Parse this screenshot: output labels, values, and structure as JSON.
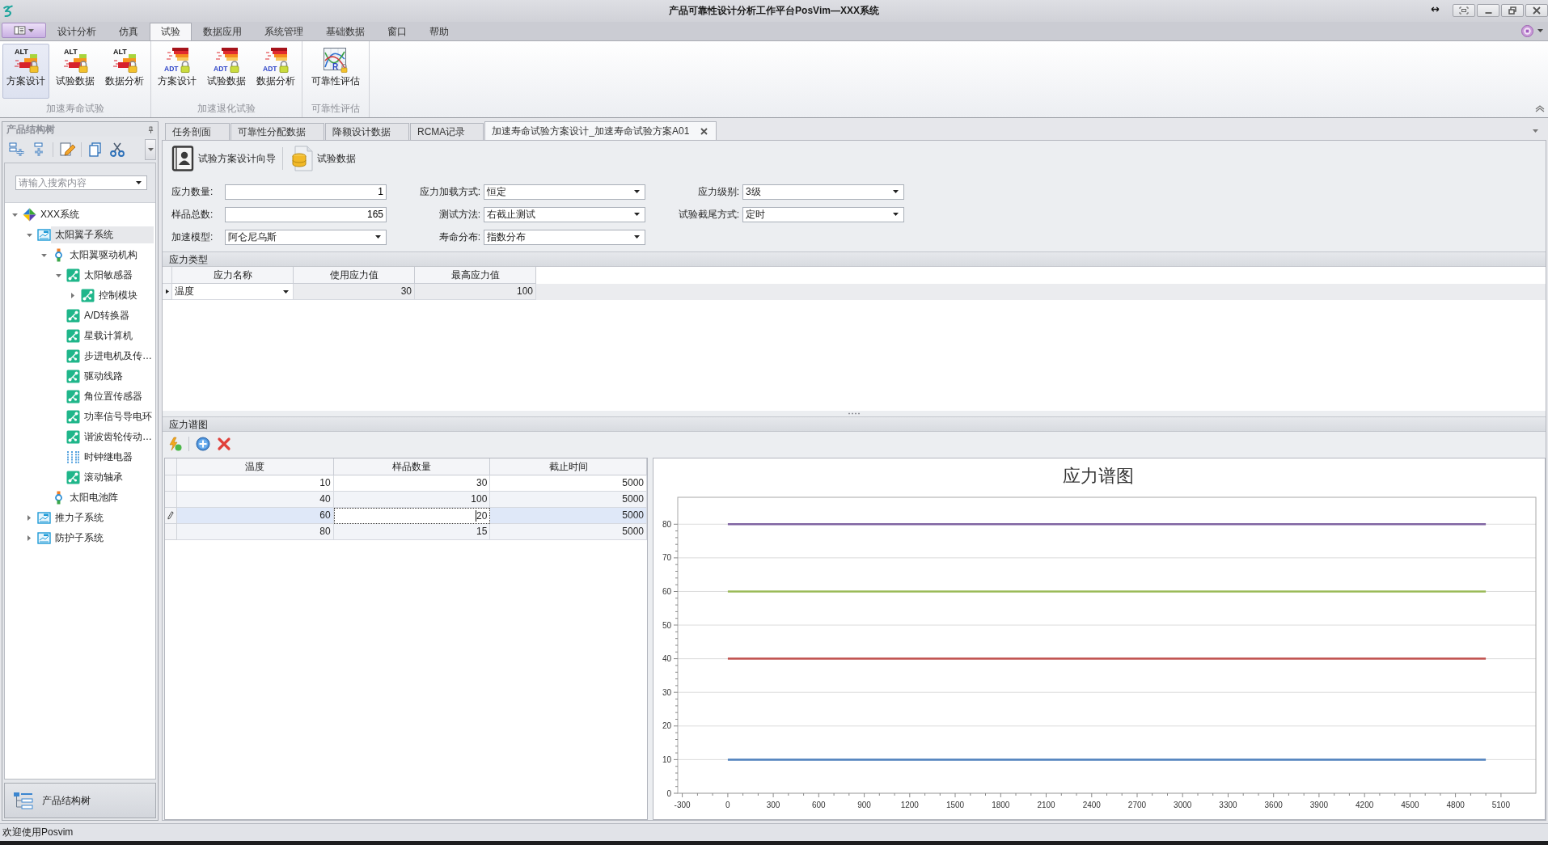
{
  "window": {
    "title": "产品可靠性设计分析工作平台PosVim—XXX系统"
  },
  "menu_tabs": [
    {
      "label": "设计分析",
      "selected": false
    },
    {
      "label": "仿真",
      "selected": false
    },
    {
      "label": "试验",
      "selected": true
    },
    {
      "label": "数据应用",
      "selected": false
    },
    {
      "label": "系统管理",
      "selected": false
    },
    {
      "label": "基础数据",
      "selected": false
    },
    {
      "label": "窗口",
      "selected": false
    },
    {
      "label": "帮助",
      "selected": false
    }
  ],
  "ribbon": [
    {
      "title": "加速寿命试验",
      "buttons": [
        {
          "label": "方案设计",
          "kind": "alt",
          "icon_text": "ALT",
          "selected": true
        },
        {
          "label": "试验数据",
          "kind": "alt",
          "icon_text": "ALT",
          "selected": false
        },
        {
          "label": "数据分析",
          "kind": "alt",
          "icon_text": "ALT",
          "selected": false
        }
      ]
    },
    {
      "title": "加速退化试验",
      "buttons": [
        {
          "label": "方案设计",
          "kind": "adt",
          "icon_text": "ADT",
          "selected": false
        },
        {
          "label": "试验数据",
          "kind": "adt",
          "icon_text": "ADT",
          "selected": false
        },
        {
          "label": "数据分析",
          "kind": "adt",
          "icon_text": "ADT",
          "selected": false
        }
      ]
    },
    {
      "title": "可靠性评估",
      "buttons": [
        {
          "label": "可靠性评估",
          "kind": "evaluation",
          "icon_text": "R",
          "selected": false
        }
      ]
    }
  ],
  "sidebar": {
    "title": "产品结构树",
    "search": {
      "placeholder": "请输入搜索内容"
    },
    "tree": [
      {
        "label": "XXX系统",
        "kind": "system",
        "expanded": true,
        "selected": false,
        "children": [
          {
            "label": "太阳翼子系统",
            "kind": "subsystem",
            "expanded": true,
            "selected": true,
            "children": [
              {
                "label": "太阳翼驱动机构",
                "kind": "mechanism",
                "expanded": true,
                "selected": false,
                "children": [
                  {
                    "label": "太阳敏感器",
                    "kind": "component",
                    "expanded": true,
                    "selected": false,
                    "children": [
                      {
                        "label": "控制模块",
                        "kind": "component",
                        "expanded": false,
                        "selected": false
                      }
                    ]
                  },
                  {
                    "label": "A/D转换器",
                    "kind": "component",
                    "selected": false
                  },
                  {
                    "label": "星载计算机",
                    "kind": "component",
                    "selected": false
                  },
                  {
                    "label": "步进电机及传…",
                    "kind": "component",
                    "selected": false
                  },
                  {
                    "label": "驱动线路",
                    "kind": "component",
                    "selected": false
                  },
                  {
                    "label": "角位置传感器",
                    "kind": "component",
                    "selected": false
                  },
                  {
                    "label": "功率信号导电环",
                    "kind": "component",
                    "selected": false
                  },
                  {
                    "label": "谐波齿轮传动…",
                    "kind": "component",
                    "selected": false
                  },
                  {
                    "label": "时钟继电器",
                    "kind": "relay",
                    "selected": false
                  },
                  {
                    "label": "滚动轴承",
                    "kind": "component",
                    "selected": false
                  }
                ]
              },
              {
                "label": "太阳电池阵",
                "kind": "mechanism",
                "selected": false
              }
            ]
          },
          {
            "label": "推力子系统",
            "kind": "subsystem",
            "expanded": false,
            "selected": false
          },
          {
            "label": "防护子系统",
            "kind": "subsystem",
            "expanded": false,
            "selected": false
          }
        ]
      }
    ],
    "nav_button": "产品结构树"
  },
  "document_tabs": [
    {
      "label": "任务剖面",
      "selected": false
    },
    {
      "label": "可靠性分配数据",
      "selected": false
    },
    {
      "label": "降额设计数据",
      "selected": false
    },
    {
      "label": "RCMA记录",
      "selected": false
    },
    {
      "label": "加速寿命试验方案设计_加速寿命试验方案A01",
      "selected": true
    }
  ],
  "toolbar": [
    {
      "label": "试验方案设计向导",
      "kind": "wizard"
    },
    {
      "label": "试验数据",
      "kind": "data"
    }
  ],
  "form": [
    {
      "label": "应力数量:",
      "value": "1",
      "kind": "number"
    },
    {
      "label": "应力加载方式:",
      "value": "恒定",
      "kind": "select"
    },
    {
      "label": "应力级别:",
      "value": "3级",
      "kind": "select"
    },
    {
      "label": "样品总数:",
      "value": "165",
      "kind": "number"
    },
    {
      "label": "测试方法:",
      "value": "右截止测试",
      "kind": "select"
    },
    {
      "label": "试验截尾方式:",
      "value": "定时",
      "kind": "select"
    },
    {
      "label": "加速模型:",
      "value": "阿仑尼乌斯",
      "kind": "select"
    },
    {
      "label": "寿命分布:",
      "value": "指数分布",
      "kind": "select"
    }
  ],
  "stress_types": {
    "title": "应力类型",
    "columns": [
      {
        "label": "应力名称",
        "kind": "select"
      },
      {
        "label": "使用应力值",
        "kind": "number"
      },
      {
        "label": "最高应力值",
        "kind": "number"
      }
    ],
    "rows": [
      {
        "selected": true,
        "cells": [
          {
            "text": "温度",
            "focused": true
          },
          {
            "text": "30",
            "focused": false
          },
          {
            "text": "100",
            "focused": false
          }
        ]
      }
    ]
  },
  "spectrum": {
    "title": "应力谱图",
    "columns": [
      {
        "label": "温度",
        "kind": "number"
      },
      {
        "label": "样品数量",
        "kind": "number"
      },
      {
        "label": "截止时间",
        "kind": "number"
      }
    ],
    "rows": [
      {
        "selected": false,
        "editing": false,
        "cells": [
          {
            "text": "10",
            "focused": false
          },
          {
            "text": "30",
            "focused": false
          },
          {
            "text": "5000",
            "focused": false
          }
        ]
      },
      {
        "selected": false,
        "editing": false,
        "cells": [
          {
            "text": "40",
            "focused": false
          },
          {
            "text": "100",
            "focused": false
          },
          {
            "text": "5000",
            "focused": false
          }
        ]
      },
      {
        "selected": true,
        "editing": true,
        "cells": [
          {
            "text": "60",
            "focused": false
          },
          {
            "text": "20",
            "focused": true
          },
          {
            "text": "5000",
            "focused": false
          }
        ]
      },
      {
        "selected": false,
        "editing": false,
        "cells": [
          {
            "text": "80",
            "focused": false
          },
          {
            "text": "15",
            "focused": false
          },
          {
            "text": "5000",
            "focused": false
          }
        ]
      }
    ],
    "chart_data": {
      "type": "line",
      "title": "应力谱图",
      "x": [
        0,
        5000
      ],
      "series": [
        {
          "color": "#4f81bd",
          "values": [
            10,
            10
          ]
        },
        {
          "color": "#c0504d",
          "values": [
            40,
            40
          ]
        },
        {
          "color": "#9bbb59",
          "values": [
            60,
            60
          ]
        },
        {
          "color": "#8064a2",
          "values": [
            80,
            80
          ]
        }
      ],
      "xlim": [
        -330,
        5330
      ],
      "ylim": [
        0,
        88
      ],
      "xticks": [
        -300,
        0,
        300,
        600,
        900,
        1200,
        1500,
        1800,
        2100,
        2400,
        2700,
        3000,
        3300,
        3600,
        3900,
        4200,
        4500,
        4800,
        5100
      ],
      "yticks": [
        0,
        10,
        20,
        30,
        40,
        50,
        60,
        70,
        80
      ],
      "grid": true
    }
  },
  "status_bar": {
    "text": "欢迎使用Posvim"
  }
}
